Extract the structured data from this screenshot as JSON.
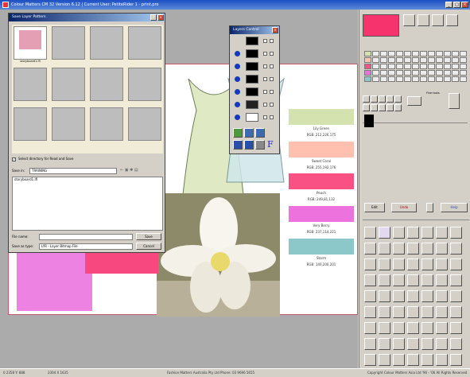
{
  "app": {
    "title": "Colour Matters CM 32 Version 6.12 | Current User: PetiteRider 1 - print.pro",
    "window_controls": [
      "_",
      "□",
      "×"
    ]
  },
  "save_dialog": {
    "title": "Save Layer Pattern",
    "thumb_label": "storyboard1.lfl",
    "checkbox_label": "Select directory for Read and Save",
    "save_in_label": "Save in:",
    "save_in_value": "TRAINING",
    "file_list": [
      "storyboard1.lfl"
    ],
    "file_name_label": "File name:",
    "file_name_value": "",
    "save_as_type_label": "Save as type:",
    "save_as_type_value": "LYR - Layer Bitmap File",
    "save_button": "Save",
    "cancel_button": "Cancel"
  },
  "layers_dialog": {
    "title": "Layers Control",
    "layer_count": 9
  },
  "swatches": [
    {
      "name": "Lily Green",
      "rgb": "RGB: 212,226,175",
      "color": "#d4e2af"
    },
    {
      "name": "Sweet Coral",
      "rgb": "RGB: 255,192,176",
      "color": "#ffc0b0"
    },
    {
      "name": "Peach",
      "rgb": "RGB: 249,81,132",
      "color": "#f95184"
    },
    {
      "name": "Very Berry",
      "rgb": "RGB: 237,114,221",
      "color": "#ed72dd"
    },
    {
      "name": "Storm",
      "rgb": "RGB: 140,200,201",
      "color": "#8cc8c9"
    }
  ],
  "right_panel": {
    "fore_color": "#f7336e",
    "edit_label": "Edit",
    "undo_label": "Undo",
    "help_label": "Help",
    "preview_label": "Fine tools",
    "palette_colors": [
      "#d4e2af",
      "#ffc0b0",
      "#f95184",
      "#ed72dd",
      "#8cc8c9",
      "#f7336e"
    ]
  },
  "status": {
    "left": "0 2358 Y: 888",
    "size": "2304 X 1635",
    "center": "Fashion Matters Australia Pty Ltd Phone: 03 9696 5655",
    "right": "Copyright Colour Matters Asia Ltd '96 - '06 All Rights Reserved"
  }
}
